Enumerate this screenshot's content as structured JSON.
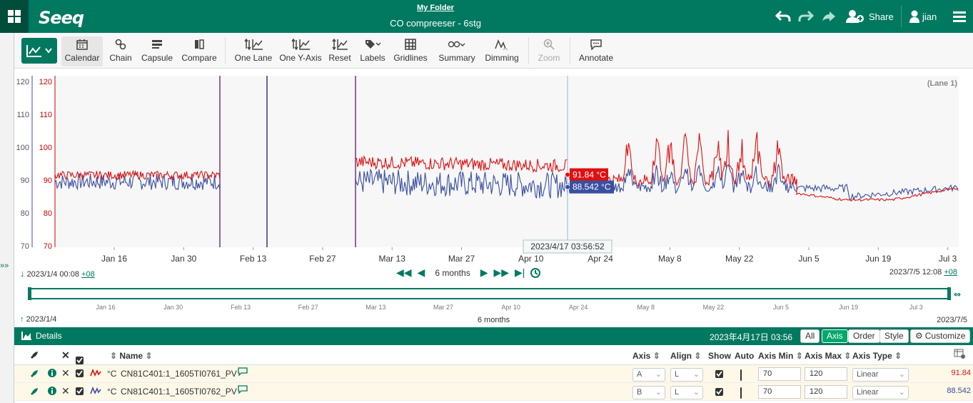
{
  "header": {
    "logo": "Seeq",
    "folder": "My Folder",
    "title": "CO compreeser - 6stg",
    "share": "Share",
    "user": "jian"
  },
  "toolbar": {
    "tools": [
      {
        "label": "Calendar",
        "icon": "calendar-icon"
      },
      {
        "label": "Chain",
        "icon": "chain-icon"
      },
      {
        "label": "Capsule",
        "icon": "capsule-icon"
      },
      {
        "label": "Compare",
        "icon": "compare-icon"
      },
      {
        "label": "One Lane",
        "icon": "one-lane-icon"
      },
      {
        "label": "One Y-Axis",
        "icon": "one-y-axis-icon"
      },
      {
        "label": "Reset",
        "icon": "reset-icon"
      },
      {
        "label": "Labels",
        "icon": "labels-icon"
      },
      {
        "label": "Gridlines",
        "icon": "gridlines-icon"
      },
      {
        "label": "Summary",
        "icon": "summary-icon"
      },
      {
        "label": "Dimming",
        "icon": "dimming-icon"
      },
      {
        "label": "Zoom",
        "icon": "zoom-icon"
      },
      {
        "label": "Annotate",
        "icon": "annotate-icon"
      }
    ]
  },
  "chart_data": {
    "type": "line",
    "lane_label": "(Lane 1)",
    "axes": [
      {
        "name": "A",
        "color": "#cc0000",
        "ticks": [
          "120",
          "110",
          "100",
          "90",
          "80",
          "70"
        ],
        "ylim": [
          70,
          120
        ]
      },
      {
        "name": "B",
        "color": "#3a4fa0",
        "ticks": [
          "120",
          "110",
          "100",
          "90",
          "80",
          "70"
        ],
        "ylim": [
          70,
          120
        ]
      }
    ],
    "x_ticks": [
      "Jan 16",
      "Jan 30",
      "Feb 13",
      "Feb 27",
      "Mar 13",
      "Mar 27",
      "Apr 10",
      "Apr 24",
      "May 8",
      "May 22",
      "Jun 5",
      "Jun 19",
      "Jul 3"
    ],
    "cursor": {
      "label": "2023/4/17 03:56:52"
    },
    "series": [
      {
        "name": "CN81C401:1_1605TI0761_PV",
        "color": "#dd1111",
        "value_label": "91.84 °C"
      },
      {
        "name": "CN81C401:1_1605TI0762_PV",
        "color": "#3a4fa0",
        "value_label": "88.542 °C"
      }
    ]
  },
  "range": {
    "start": "2023/1/4 00:08",
    "start_tz": "+08",
    "end": "2023/7/5 12:08",
    "end_tz": "+08",
    "duration": "6 months"
  },
  "overview": {
    "ticks": [
      "Jan 16",
      "Jan 30",
      "Feb 13",
      "Feb 27",
      "Mar 13",
      "Mar 27",
      "Apr 10",
      "Apr 24",
      "May 8",
      "May 22",
      "Jun 5",
      "Jun 19",
      "Jul 3"
    ],
    "start": "2023/1/4",
    "end": "2023/7/5",
    "duration": "6 months"
  },
  "details": {
    "title": "Details",
    "timestamp": "2023年4月17日 03:56",
    "buttons": [
      "All",
      "Axis",
      "Order",
      "Style",
      "Customize"
    ]
  },
  "table": {
    "headers": {
      "name": "Name",
      "axis": "Axis",
      "align": "Align",
      "show": "Show",
      "auto": "Auto",
      "axis_min": "Axis Min",
      "axis_max": "Axis Max",
      "axis_type": "Axis Type"
    },
    "rows": [
      {
        "unit": "°C",
        "name": "CN81C401:1_1605TI0761_PV",
        "axis": "A",
        "align": "L",
        "min": "70",
        "max": "120",
        "type": "Linear",
        "value": "91.84",
        "color": "#dd1111"
      },
      {
        "unit": "°C",
        "name": "CN81C401:1_1605TI0762_PV",
        "axis": "B",
        "align": "L",
        "min": "70",
        "max": "120",
        "type": "Linear",
        "value": "88.542",
        "color": "#3a4fa0"
      }
    ]
  }
}
